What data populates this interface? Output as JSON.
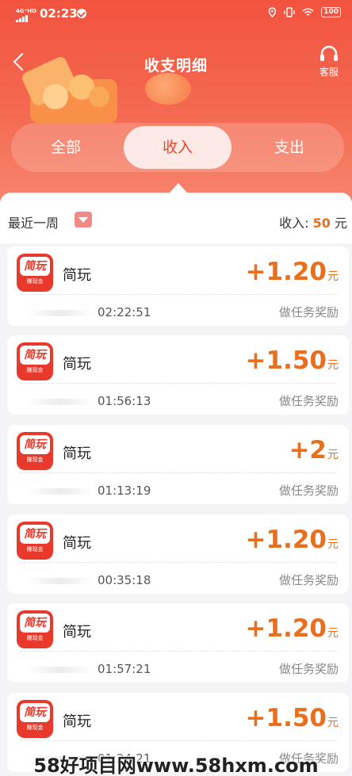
{
  "status": {
    "network": "4G⁺HD",
    "time": "02:23",
    "battery": "100"
  },
  "header": {
    "title": "收支明细",
    "service_label": "客服"
  },
  "tabs": [
    {
      "label": "全部",
      "active": false
    },
    {
      "label": "收入",
      "active": true
    },
    {
      "label": "支出",
      "active": false
    }
  ],
  "filter": {
    "range_label": "最近一周",
    "income_prefix": "收入:",
    "income_amount": "50",
    "income_unit": "元"
  },
  "records": [
    {
      "app_name": "简玩",
      "app_icon_text": "简玩",
      "app_icon_sub": "赚现金",
      "amount": "+1.20",
      "unit": "元",
      "time": "02:22:51",
      "type": "做任务奖励"
    },
    {
      "app_name": "简玩",
      "app_icon_text": "简玩",
      "app_icon_sub": "赚现金",
      "amount": "+1.50",
      "unit": "元",
      "time": "01:56:13",
      "type": "做任务奖励"
    },
    {
      "app_name": "简玩",
      "app_icon_text": "简玩",
      "app_icon_sub": "赚现金",
      "amount": "+2",
      "unit": "元",
      "time": "01:13:19",
      "type": "做任务奖励"
    },
    {
      "app_name": "简玩",
      "app_icon_text": "简玩",
      "app_icon_sub": "赚现金",
      "amount": "+1.20",
      "unit": "元",
      "time": "00:35:18",
      "type": "做任务奖励"
    },
    {
      "app_name": "简玩",
      "app_icon_text": "简玩",
      "app_icon_sub": "赚现金",
      "amount": "+1.20",
      "unit": "元",
      "time": "01:57:21",
      "type": "做任务奖励"
    },
    {
      "app_name": "简玩",
      "app_icon_text": "简玩",
      "app_icon_sub": "赚现金",
      "amount": "+1.50",
      "unit": "元",
      "time": "01:24:21",
      "type": "做任务奖励"
    }
  ],
  "watermark": "58好项目网www.58hxm.com",
  "colors": {
    "header_red": "#f2533f",
    "amount_orange": "#e76f1e",
    "tab_active_bg": "#fde9e6"
  }
}
